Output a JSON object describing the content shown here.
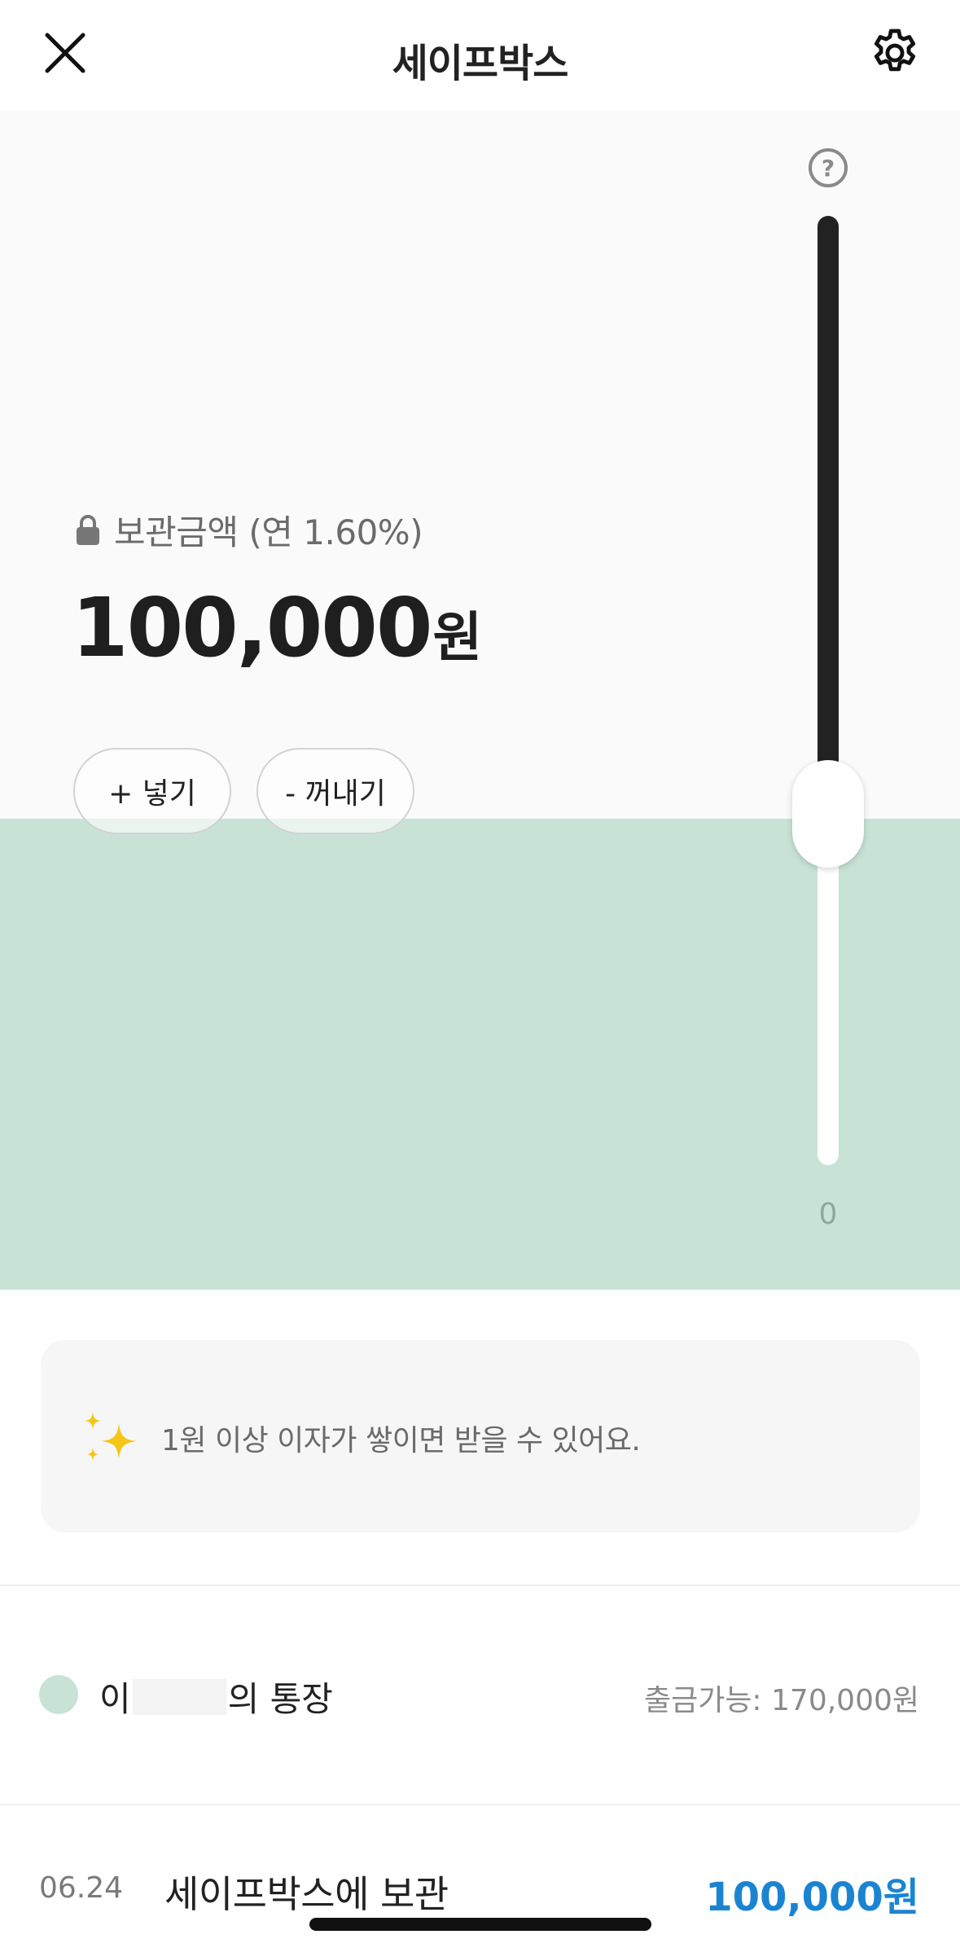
{
  "header": {
    "title": "세이프박스",
    "close_icon": "close-icon",
    "settings_icon": "gear-icon"
  },
  "balance": {
    "label": "보관금액 (연 1.60%)",
    "amount": "100,000",
    "unit": "원",
    "lock_icon": "lock-icon"
  },
  "actions": {
    "deposit_label": "+ 넣기",
    "withdraw_label": "- 꺼내기"
  },
  "slider": {
    "help_label": "?",
    "min_label": "0",
    "fill_fraction": 0.5
  },
  "info": {
    "icon": "sparkle-icon",
    "text": "1원 이상 이자가 쌓이면 받을 수 있어요."
  },
  "account": {
    "name_prefix": "이",
    "name_suffix": "의 통장",
    "withdrawable": "출금가능: 170,000원"
  },
  "transactions": [
    {
      "date": "06.24",
      "description": "세이프박스에 보관",
      "amount": "100,000원"
    }
  ],
  "colors": {
    "accent_green": "#c8e3d6",
    "amount_blue": "#1b84d2",
    "sparkle_yellow": "#f5c518"
  }
}
